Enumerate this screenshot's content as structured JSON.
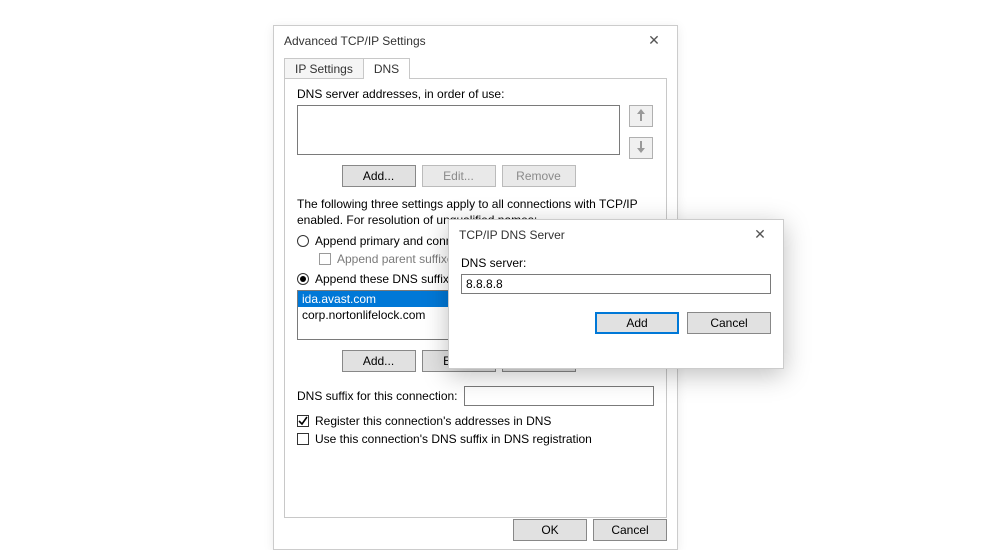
{
  "main": {
    "title": "Advanced TCP/IP Settings",
    "tabs": {
      "ip": "IP Settings",
      "dns": "DNS"
    },
    "dns_label": "DNS server addresses, in order of use:",
    "add": "Add...",
    "edit": "Edit...",
    "remove": "Remove",
    "settings_text": "The following three settings apply to all connections with TCP/IP enabled. For resolution of unqualified names:",
    "radio1": "Append primary and connection specific DNS suffixes",
    "radio1_sub": "Append parent suffixes of the primary DNS suffix",
    "radio2": "Append these DNS suffixes (in order):",
    "suffixes": [
      "ida.avast.com",
      "corp.nortonlifelock.com"
    ],
    "suffix_conn_label": "DNS suffix for this connection:",
    "suffix_conn_value": "",
    "chk_register": "Register this connection's addresses in DNS",
    "chk_usesuffix": "Use this connection's DNS suffix in DNS registration",
    "ok": "OK",
    "cancel": "Cancel"
  },
  "modal": {
    "title": "TCP/IP DNS Server",
    "field_label": "DNS server:",
    "value": "8.8.8.8",
    "add": "Add",
    "cancel": "Cancel"
  }
}
